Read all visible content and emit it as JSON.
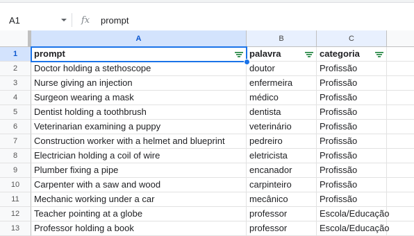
{
  "formula_bar": {
    "cell_ref": "A1",
    "fx_label": "fx",
    "value": "prompt"
  },
  "columns": [
    "A",
    "B",
    "C"
  ],
  "rows": [
    {
      "num": "1",
      "a": "prompt",
      "b": "palavra",
      "c": "categoria"
    },
    {
      "num": "2",
      "a": "Doctor holding a stethoscope",
      "b": "doutor",
      "c": "Profissão"
    },
    {
      "num": "3",
      "a": "Nurse giving an injection",
      "b": "enfermeira",
      "c": "Profissão"
    },
    {
      "num": "4",
      "a": "Surgeon wearing a mask",
      "b": "médico",
      "c": "Profissão"
    },
    {
      "num": "5",
      "a": "Dentist holding a toothbrush",
      "b": "dentista",
      "c": "Profissão"
    },
    {
      "num": "6",
      "a": "Veterinarian examining a puppy",
      "b": "veterinário",
      "c": "Profissão"
    },
    {
      "num": "7",
      "a": "Construction worker with a helmet and blueprint",
      "b": "pedreiro",
      "c": "Profissão"
    },
    {
      "num": "8",
      "a": "Electrician holding a coil of wire",
      "b": "eletricista",
      "c": "Profissão"
    },
    {
      "num": "9",
      "a": "Plumber fixing a pipe",
      "b": "encanador",
      "c": "Profissão"
    },
    {
      "num": "10",
      "a": "Carpenter with a saw and wood",
      "b": "carpinteiro",
      "c": "Profissão"
    },
    {
      "num": "11",
      "a": "Mechanic working under a car",
      "b": "mecânico",
      "c": "Profissão"
    },
    {
      "num": "12",
      "a": "Teacher pointing at a globe",
      "b": "professor",
      "c": "Escola/Educação"
    },
    {
      "num": "13",
      "a": "Professor holding a book",
      "b": "professor",
      "c": "Escola/Educação"
    }
  ],
  "colors": {
    "accent": "#1a73e8",
    "filter_green": "#188038"
  },
  "icons": {
    "filter": "filter-icon",
    "dropdown": "chevron-down-icon",
    "fx": "fx-icon"
  }
}
